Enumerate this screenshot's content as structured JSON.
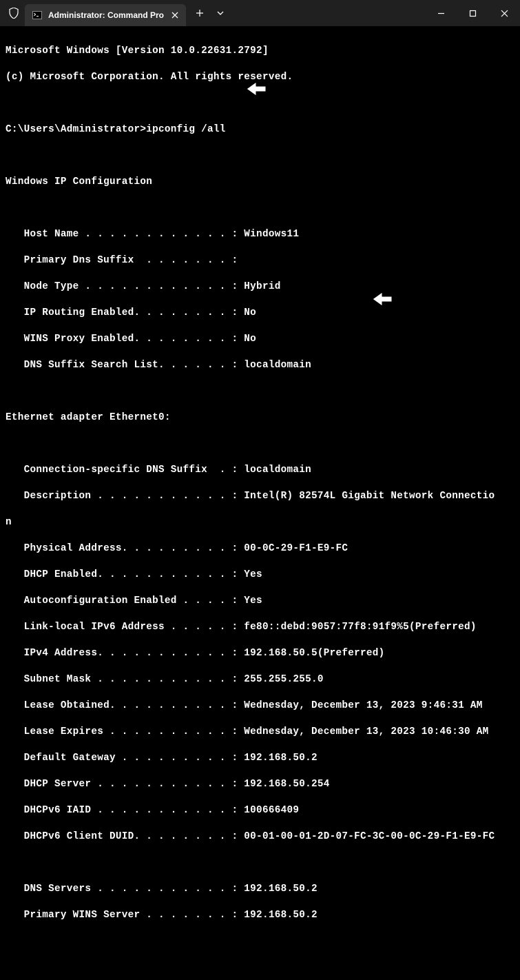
{
  "window": {
    "tab_title": "Administrator: Command Pro"
  },
  "header": {
    "line1": "Microsoft Windows [Version 10.0.22631.2792]",
    "line2": "(c) Microsoft Corporation. All rights reserved."
  },
  "prompt": {
    "path": "C:\\Users\\Administrator>",
    "command": "ipconfig /all"
  },
  "ipconfig": {
    "title": "Windows IP Configuration",
    "host_name": "   Host Name . . . . . . . . . . . . : Windows11",
    "primary_dns": "   Primary Dns Suffix  . . . . . . . :",
    "node_type": "   Node Type . . . . . . . . . . . . : Hybrid",
    "ip_routing": "   IP Routing Enabled. . . . . . . . : No",
    "wins_proxy": "   WINS Proxy Enabled. . . . . . . . : No",
    "dns_suffix_list": "   DNS Suffix Search List. . . . . . : localdomain"
  },
  "adapter": {
    "title": "Ethernet adapter Ethernet0:",
    "conn_dns": "   Connection-specific DNS Suffix  . : localdomain",
    "description": "   Description . . . . . . . . . . . : Intel(R) 82574L Gigabit Network Connectio",
    "desc_wrap": "n",
    "physical": "   Physical Address. . . . . . . . . : 00-0C-29-F1-E9-FC",
    "dhcp_enabled": "   DHCP Enabled. . . . . . . . . . . : Yes",
    "autoconfig": "   Autoconfiguration Enabled . . . . : Yes",
    "link_local": "   Link-local IPv6 Address . . . . . : fe80::debd:9057:77f8:91f9%5(Preferred)",
    "ipv4": "   IPv4 Address. . . . . . . . . . . : 192.168.50.5(Preferred)",
    "subnet": "   Subnet Mask . . . . . . . . . . . : 255.255.255.0",
    "lease_obtained": "   Lease Obtained. . . . . . . . . . : Wednesday, December 13, 2023 9:46:31 AM",
    "lease_expires": "   Lease Expires . . . . . . . . . . : Wednesday, December 13, 2023 10:46:30 AM",
    "default_gw": "   Default Gateway . . . . . . . . . : 192.168.50.2",
    "dhcp_server": "   DHCP Server . . . . . . . . . . . : 192.168.50.254",
    "dhcpv6_iaid": "   DHCPv6 IAID . . . . . . . . . . . : 100666409",
    "dhcpv6_duid": "   DHCPv6 Client DUID. . . . . . . . : 00-01-00-01-2D-07-FC-3C-00-0C-29-F1-E9-FC",
    "dns_servers": "   DNS Servers . . . . . . . . . . . : 192.168.50.2",
    "primary_wins": "   Primary WINS Server . . . . . . . : 192.168.50.2"
  }
}
